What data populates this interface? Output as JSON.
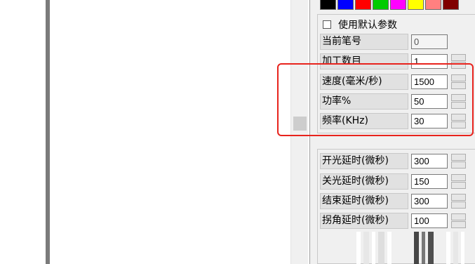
{
  "colors": {
    "swatches": [
      "#000000",
      "#0000ff",
      "#ff0000",
      "#00cc00",
      "#ff00ff",
      "#ffff00",
      "#ff8080",
      "#800000"
    ],
    "highlight": "#e8231d"
  },
  "default_params_checkbox": {
    "label": "使用默认参数",
    "checked": false
  },
  "params_top": [
    {
      "label": "当前笔号",
      "value": "0",
      "spinner": false
    },
    {
      "label": "加工数目",
      "value": "1",
      "spinner": true
    },
    {
      "label": "速度(毫米/秒)",
      "value": "1500",
      "spinner": true
    },
    {
      "label": "功率%",
      "value": "50",
      "spinner": true
    },
    {
      "label": "频率(KHz)",
      "value": "30",
      "spinner": true
    }
  ],
  "params_delay": [
    {
      "label": "开光延时(微秒)",
      "value": "300"
    },
    {
      "label": "关光延时(微秒)",
      "value": "150"
    },
    {
      "label": "结束延时(微秒)",
      "value": "300"
    },
    {
      "label": "拐角延时(微秒)",
      "value": "100"
    }
  ]
}
